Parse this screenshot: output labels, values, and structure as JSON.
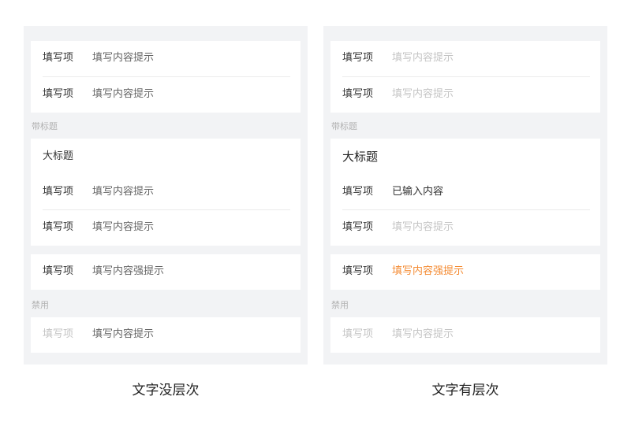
{
  "left": {
    "card1": [
      {
        "label": "填写项",
        "value": "填写内容提示"
      },
      {
        "label": "填写项",
        "value": "填写内容提示"
      }
    ],
    "section_title_1": "带标题",
    "card2_title": "大标题",
    "card2": [
      {
        "label": "填写项",
        "value": "填写内容提示"
      },
      {
        "label": "填写项",
        "value": "填写内容提示"
      }
    ],
    "card3": {
      "label": "填写项",
      "value": "填写内容强提示"
    },
    "section_title_2": "禁用",
    "card4": {
      "label": "填写项",
      "value": "填写内容提示"
    },
    "caption": "文字没层次"
  },
  "right": {
    "card1": [
      {
        "label": "填写项",
        "value": "填写内容提示"
      },
      {
        "label": "填写项",
        "value": "填写内容提示"
      }
    ],
    "section_title_1": "带标题",
    "card2_title": "大标题",
    "card2": [
      {
        "label": "填写项",
        "value": "已输入内容"
      },
      {
        "label": "填写项",
        "value": "填写内容提示"
      }
    ],
    "card3": {
      "label": "填写项",
      "value": "填写内容强提示"
    },
    "section_title_2": "禁用",
    "card4": {
      "label": "填写项",
      "value": "填写内容提示"
    },
    "caption": "文字有层次"
  },
  "colors": {
    "panel_bg": "#f2f3f5",
    "card_bg": "#ffffff",
    "placeholder": "#c4c4c4",
    "strong_hint": "#f48b33",
    "text": "#333333"
  }
}
